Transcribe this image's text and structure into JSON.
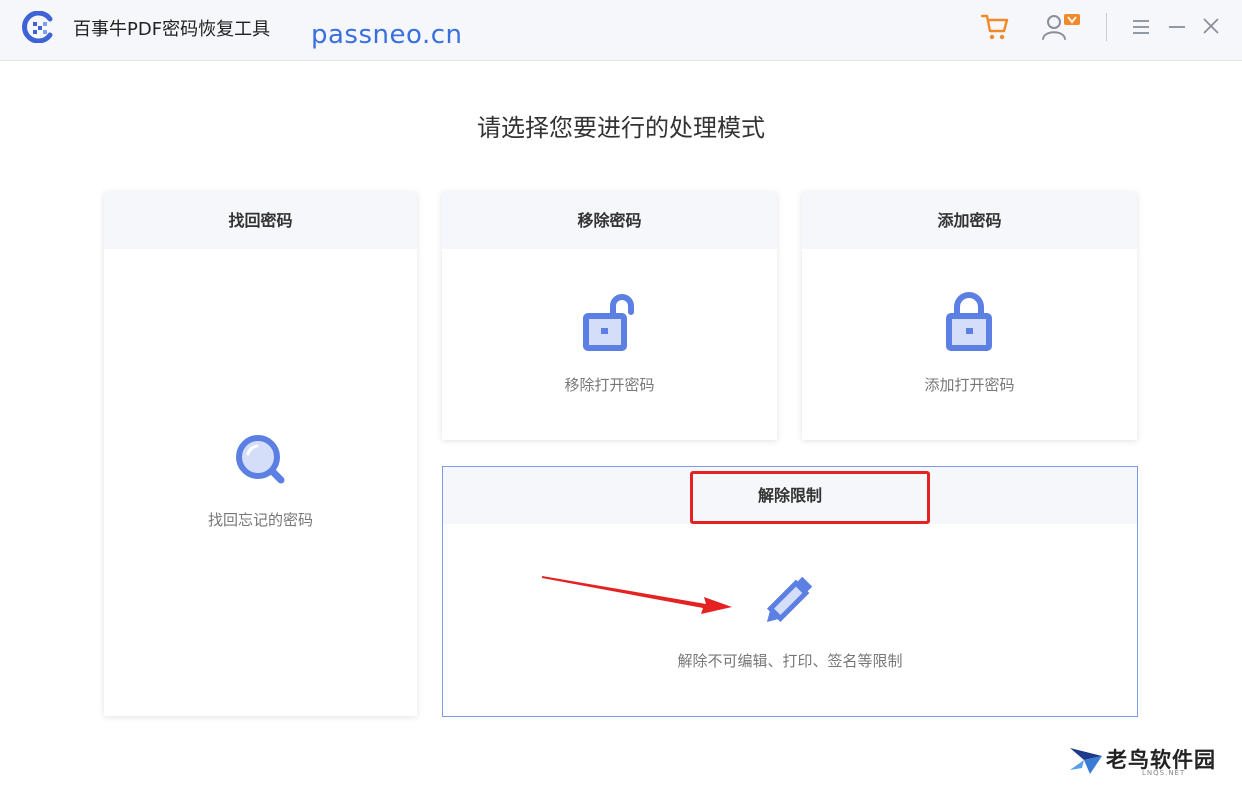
{
  "app": {
    "title": "百事牛PDF密码恢复工具",
    "watermark_url": "passneo.cn"
  },
  "main": {
    "heading": "请选择您要进行的处理模式"
  },
  "cards": {
    "find": {
      "title": "找回密码",
      "desc": "找回忘记的密码",
      "icon": "magnifier-icon"
    },
    "remove": {
      "title": "移除密码",
      "desc": "移除打开密码",
      "icon": "unlocked-padlock-icon"
    },
    "add": {
      "title": "添加密码",
      "desc": "添加打开密码",
      "icon": "padlock-icon"
    },
    "unlock": {
      "title": "解除限制",
      "desc": "解除不可编辑、打印、签名等限制",
      "icon": "pencil-icon"
    }
  },
  "brand": {
    "name": "老鸟软件园",
    "sub": "LNQS.NET"
  },
  "colors": {
    "accent": "#5b7fe2",
    "icon_light": "#d5def8",
    "cart": "#f08a2a",
    "highlight": "#e52222"
  }
}
